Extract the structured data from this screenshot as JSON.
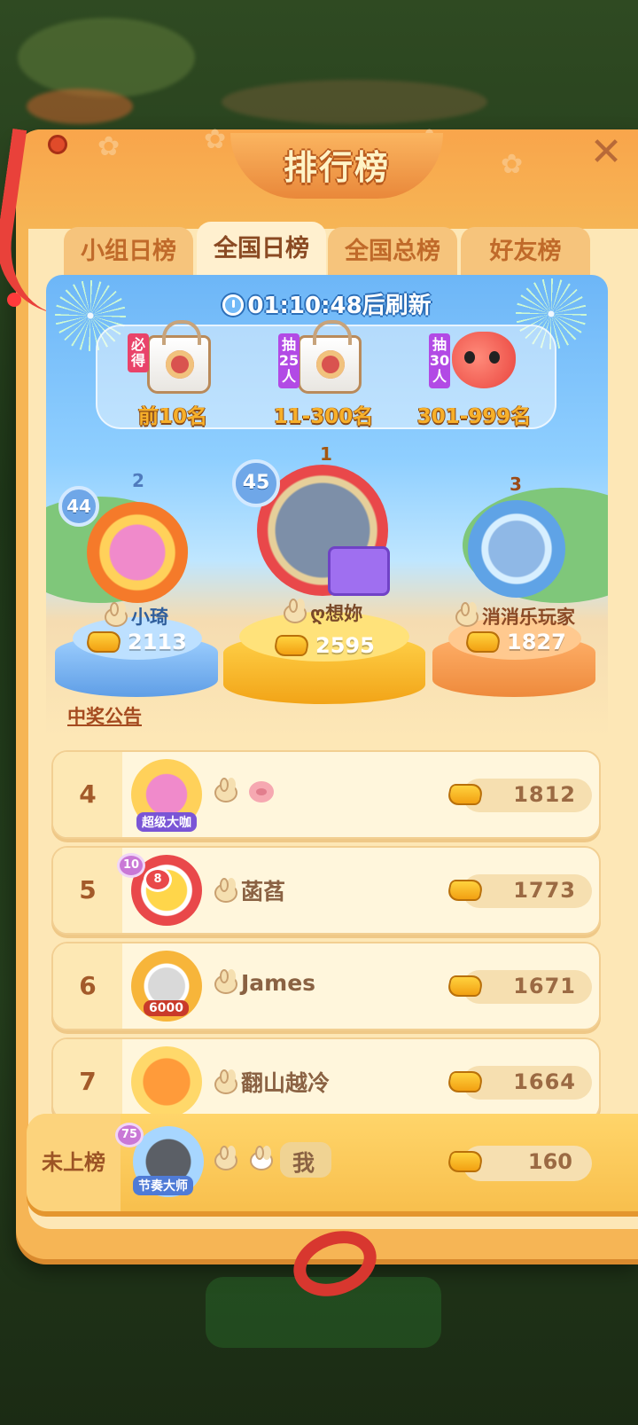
{
  "header": {
    "title": "排行榜"
  },
  "tabs": [
    {
      "label": "小组日榜",
      "active": false
    },
    {
      "label": "全国日榜",
      "active": true
    },
    {
      "label": "全国总榜",
      "active": false
    },
    {
      "label": "好友榜",
      "active": false
    }
  ],
  "refresh_text": "01:10:48后刷新",
  "rewards": [
    {
      "tag": "必得",
      "range": "前10名"
    },
    {
      "tag": "抽25人",
      "range": "11-300名"
    },
    {
      "tag": "抽30人",
      "range": "301-999名"
    }
  ],
  "podium": {
    "first": {
      "rank": "1",
      "level": "45",
      "name": "ღ想妳",
      "score": "2595"
    },
    "second": {
      "rank": "2",
      "level": "44",
      "name": "小琦",
      "score": "2113"
    },
    "third": {
      "rank": "3",
      "name": "消消乐玩家",
      "score": "1827"
    }
  },
  "notice_label": "中奖公告",
  "list": [
    {
      "rank": "4",
      "name": "",
      "score": "1812",
      "title_tag": "超级大咖"
    },
    {
      "rank": "5",
      "name": "菡萏",
      "score": "1773",
      "level": "10",
      "sub_level": "8"
    },
    {
      "rank": "6",
      "name": "James",
      "score": "1671",
      "title_tag": "6000"
    },
    {
      "rank": "7",
      "name": "翻山越冷",
      "score": "1664"
    }
  ],
  "me": {
    "rank_label": "未上榜",
    "level": "75",
    "title_tag": "节奏大师",
    "name": "我",
    "score": "160"
  },
  "colors": {
    "panel": "#f6b555",
    "stage_sky": "#6db6f7",
    "gold": "#f6c33c"
  }
}
